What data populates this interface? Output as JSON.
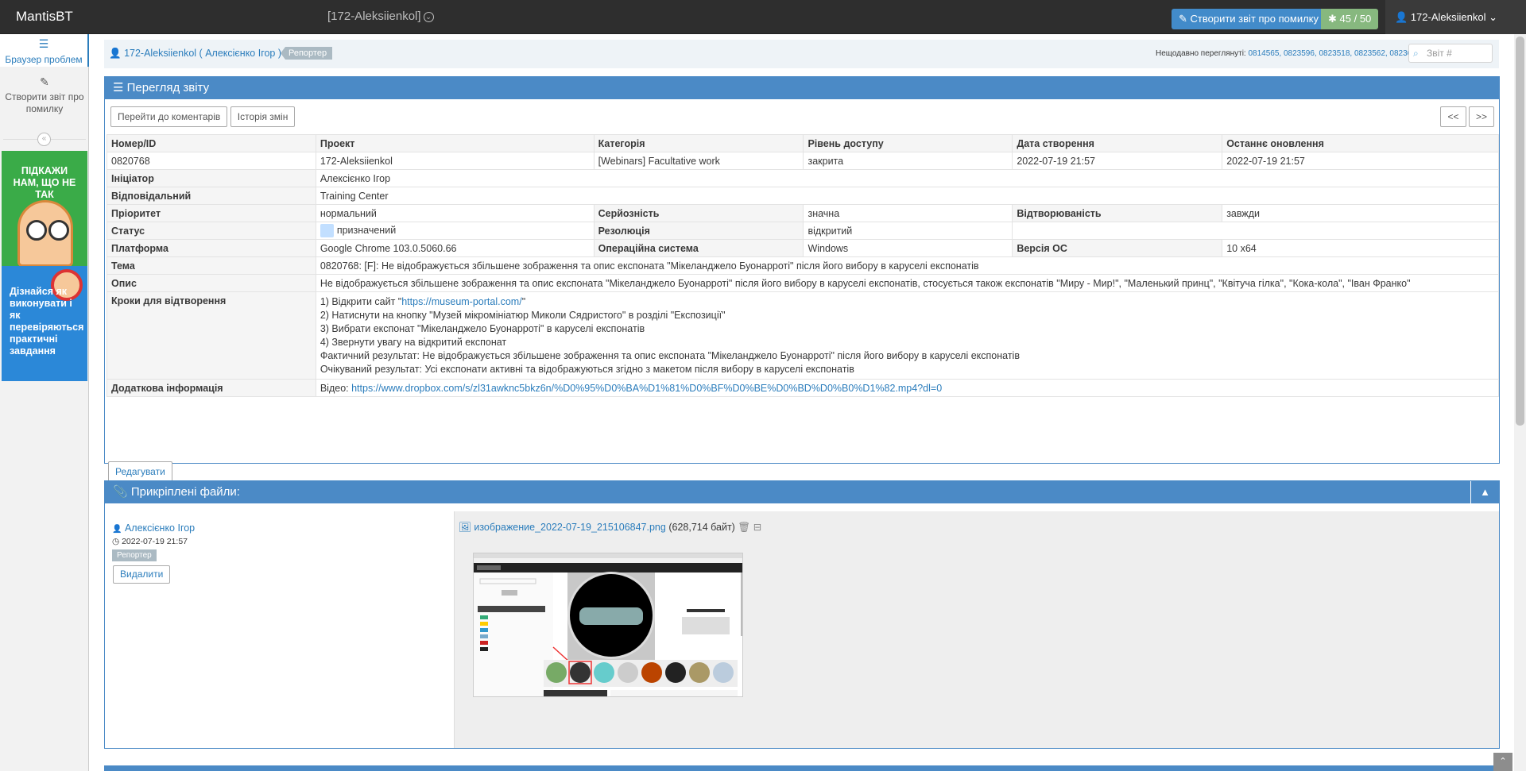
{
  "navbar": {
    "brand": "MantisBT",
    "project_selector": "[172-Aleksiienkol]",
    "report_button": "Створити звіт про помилку",
    "issue_count": "45 / 50",
    "user": "172-Aleksiienkol"
  },
  "sidebar": {
    "items": [
      {
        "label": "Браузер проблем",
        "icon": "list-icon"
      },
      {
        "label": "Створити звіт про помилку",
        "icon": "edit-icon"
      }
    ],
    "ad1_text": "ПІДКАЖИ НАМ, ЩО НЕ ТАК",
    "ad2_text": "Дізнайся як виконувати і як перевіряються практичні завдання"
  },
  "breadcrumbs": {
    "user": "172-Aleksiienkol ( Алексієнко Ігор )",
    "role_badge": "Репортер",
    "recent_label": "Нещодавно переглянуті:",
    "recent_links": "0814565, 0823596, 0823518, 0823562, 0823659",
    "search_placeholder": "Звіт #"
  },
  "view": {
    "title": "Перегляд звіту",
    "btn_comments": "Перейти до коментарів",
    "btn_history": "Історія змін",
    "btn_prev": "<<",
    "btn_next": ">>",
    "headers": [
      "Номер/ID",
      "Проект",
      "Категорія",
      "Рівень доступу",
      "Дата створення",
      "Останнє оновлення"
    ],
    "values": [
      "0820768",
      "172-Aleksiienkol",
      "[Webinars] Facultative work",
      "закрита",
      "2022-07-19 21:57",
      "2022-07-19 21:57"
    ],
    "reporter_label": "Ініціатор",
    "reporter": "Алексієнко Ігор",
    "handler_label": "Відповідальний",
    "handler": "Training Center",
    "priority_label": "Пріоритет",
    "priority": "нормальний",
    "severity_label": "Серйозність",
    "severity": "значна",
    "reproducibility_label": "Відтворюваність",
    "reproducibility": "завжди",
    "status_label": "Статус",
    "status": "призначений",
    "resolution_label": "Резолюція",
    "resolution": "відкритий",
    "platform_label": "Платформа",
    "platform": "Google Chrome 103.0.5060.66",
    "os_label": "Операційна система",
    "os": "Windows",
    "os_version_label": "Версія ОС",
    "os_version": "10 x64",
    "summary_label": "Тема",
    "summary": "0820768: [F]: Не відображується збільшене зображення та опис експоната \"Мікеланджело Буонарроті\" після його вибору в каруселі експонатів",
    "description_label": "Опис",
    "description": "Не відображується збільшене зображення та опис експоната \"Мікеланджело Буонарроті\" після його вибору в каруселі експонатів, стосується також експонатів \"Миру - Мир!\", \"Маленький принц\", \"Квітуча гілка\", \"Кока-кола\", \"Іван Франко\"",
    "steps_label": "Кроки для відтворення",
    "step1_prefix": "1) Відкрити сайт \"",
    "step1_link": "https://museum-portal.com/",
    "step1_suffix": "\"",
    "step2": "2) Натиснути на кнопку \"Музей мікромініатюр Миколи Сядристого\" в розділі \"Експозиції\"",
    "step3": "3) Вибрати експонат \"Мікеланджело Буонарроті\" в каруселі експонатів",
    "step4": "4) Звернути увагу на відкритий експонат",
    "actual": "Фактичний результат: Не відображується збільшене зображення та опис експоната \"Мікеланджело Буонарроті\" після його вибору в каруселі експонатів",
    "expected": "Очікуваний результат: Усі експонати активні та відображуються згідно з макетом після вибору в каруселі експонатів",
    "additional_label": "Додаткова інформація",
    "additional_prefix": "Відео: ",
    "additional_link": "https://www.dropbox.com/s/zl31awknc5bkz6n/%D0%95%D0%BA%D1%81%D0%BF%D0%BE%D0%BD%D0%B0%D1%82.mp4?dl=0",
    "btn_edit": "Редагувати"
  },
  "attachments": {
    "title": "Прикріплені файли:",
    "author": "Алексієнко Ігор",
    "date": "2022-07-19 21:57",
    "role": "Репортер",
    "btn_delete": "Видалити",
    "file_name": "изображение_2022-07-19_215106847.png",
    "file_size": "(628,714 байт)"
  },
  "colors": {
    "accent": "#4b8ac6",
    "link": "#2b7dbc",
    "success": "#87b87f",
    "status_assigned": "#c2dfff"
  }
}
